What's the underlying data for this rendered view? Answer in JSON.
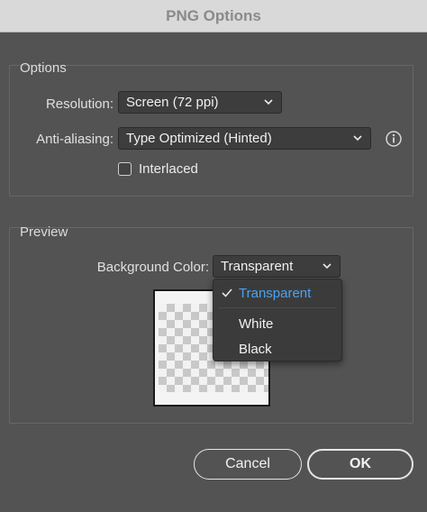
{
  "window": {
    "title": "PNG Options"
  },
  "options_group": {
    "title": "Options",
    "resolution": {
      "label": "Resolution:",
      "value": "Screen (72 ppi)"
    },
    "antialiasing": {
      "label": "Anti-aliasing:",
      "value": "Type Optimized (Hinted)"
    },
    "interlaced": {
      "label": "Interlaced",
      "checked": false
    }
  },
  "preview_group": {
    "title": "Preview",
    "background_color": {
      "label": "Background Color:",
      "value": "Transparent",
      "menu_items": [
        {
          "label": "Transparent",
          "selected": true
        },
        {
          "label": "White",
          "selected": false
        },
        {
          "label": "Black",
          "selected": false
        }
      ]
    }
  },
  "buttons": {
    "cancel": "Cancel",
    "ok": "OK"
  },
  "colors": {
    "accent": "#4aa3f3",
    "dialog_bg": "#535353"
  },
  "icons": {
    "info": "info-icon",
    "chevron": "chevron-down-icon",
    "check": "checkmark-icon"
  }
}
